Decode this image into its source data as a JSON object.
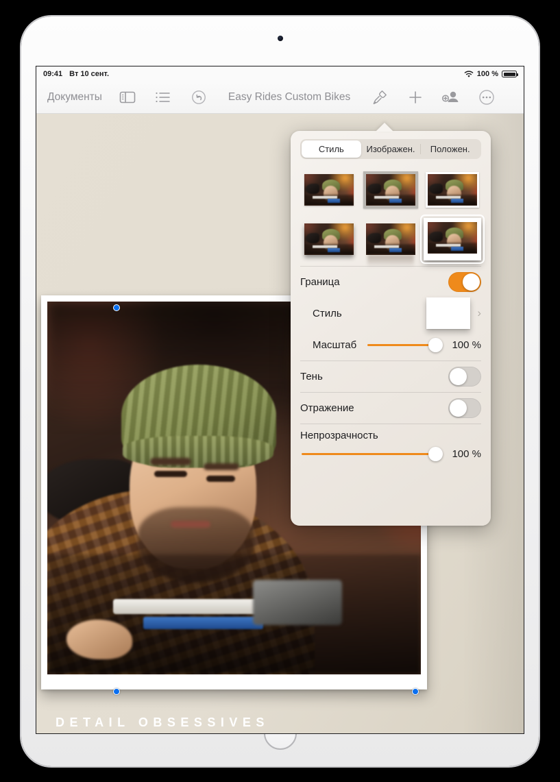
{
  "status_bar": {
    "time": "09:41",
    "date": "Вт 10 сент.",
    "wifi_icon": "wifi-icon",
    "battery_percent": "100 %",
    "battery_icon": "battery-icon"
  },
  "toolbar": {
    "documents_label": "Документы",
    "sidebar_icon": "sidebar-icon",
    "list_icon": "list-icon",
    "undo_icon": "undo-icon",
    "document_title": "Easy Rides Custom Bikes",
    "format_icon": "paintbrush-icon",
    "insert_icon": "plus-icon",
    "collaborate_icon": "add-person-icon",
    "more_icon": "ellipsis-circle-icon"
  },
  "document": {
    "caption": "DETAIL OBSESSIVES",
    "background_color": "#e3ddd1",
    "selection_handle_color": "#0a6ff0"
  },
  "popover": {
    "segmented": {
      "options": [
        "Стиль",
        "Изображен.",
        "Положен."
      ],
      "selected_index": 0
    },
    "style_thumbnails": [
      {
        "name": "style-plain",
        "selected": false
      },
      {
        "name": "style-grey-border",
        "selected": false
      },
      {
        "name": "style-thin-white-border",
        "selected": false
      },
      {
        "name": "style-drop-shadow",
        "selected": false
      },
      {
        "name": "style-reflection",
        "selected": false
      },
      {
        "name": "style-white-matte-shadow",
        "selected": true
      }
    ],
    "rows": {
      "border": {
        "label": "Граница",
        "toggle": "on"
      },
      "border_style": {
        "label": "Стиль",
        "swatch_color": "#9ccbea",
        "chevron": "chevron-right-icon"
      },
      "scale": {
        "label": "Масштаб",
        "value": "100 %",
        "fill": 100
      },
      "shadow": {
        "label": "Тень",
        "toggle": "off"
      },
      "reflection": {
        "label": "Отражение",
        "toggle": "off"
      },
      "opacity": {
        "label": "Непрозрачность",
        "value": "100 %",
        "fill": 100
      }
    },
    "accent_color": "#ef8a1b"
  }
}
